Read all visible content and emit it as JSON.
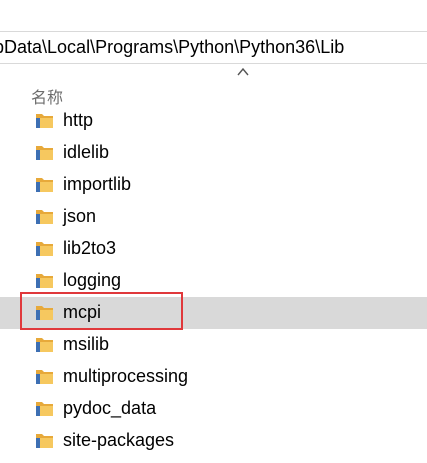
{
  "address": {
    "path": "pData\\Local\\Programs\\Python\\Python36\\Lib"
  },
  "list_header": {
    "name_label": "名称",
    "sort_icon": "chevron-up-icon"
  },
  "files": [
    {
      "name": "http",
      "icon": "folder-icon"
    },
    {
      "name": "idlelib",
      "icon": "folder-icon"
    },
    {
      "name": "importlib",
      "icon": "folder-icon"
    },
    {
      "name": "json",
      "icon": "folder-icon"
    },
    {
      "name": "lib2to3",
      "icon": "folder-icon"
    },
    {
      "name": "logging",
      "icon": "folder-icon"
    },
    {
      "name": "mcpi",
      "icon": "folder-icon",
      "selected": true
    },
    {
      "name": "msilib",
      "icon": "folder-icon"
    },
    {
      "name": "multiprocessing",
      "icon": "folder-icon"
    },
    {
      "name": "pydoc_data",
      "icon": "folder-icon"
    },
    {
      "name": "site-packages",
      "icon": "folder-icon"
    }
  ],
  "colors": {
    "selected_row": "#d9d9d9",
    "highlight_border": "#e0383b",
    "folder_yellow": "#f6c85f"
  }
}
